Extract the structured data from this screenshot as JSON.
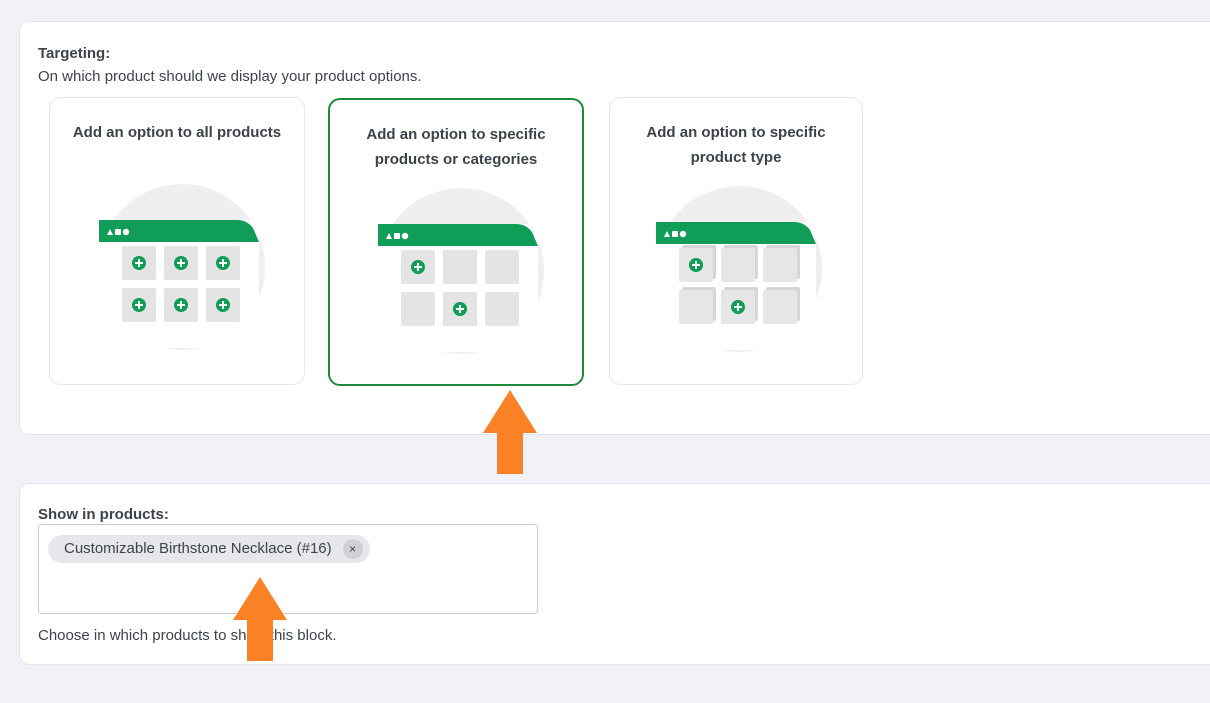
{
  "targeting": {
    "label": "Targeting:",
    "description": "On which product should we display your product options.",
    "options": [
      {
        "title": "Add an option to all products",
        "selected": false,
        "icon": "all-products-grid-illustration"
      },
      {
        "title": "Add an option to specific products or categories",
        "selected": true,
        "icon": "specific-products-grid-illustration"
      },
      {
        "title": "Add an option to specific product type",
        "selected": false,
        "icon": "product-type-grid-illustration"
      }
    ]
  },
  "show_in_products": {
    "label": "Show in products:",
    "selected_tags": [
      {
        "text": "Customizable Birthstone Necklace (#16)",
        "remove_symbol": "×"
      }
    ],
    "help_text": "Choose in which products to show this block."
  },
  "colors": {
    "accent_green": "#0f9d58",
    "selected_border": "#1f8a3b",
    "annotation_arrow": "#fb8126"
  },
  "annotations": [
    "arrow-up-icon",
    "arrow-up-icon"
  ]
}
